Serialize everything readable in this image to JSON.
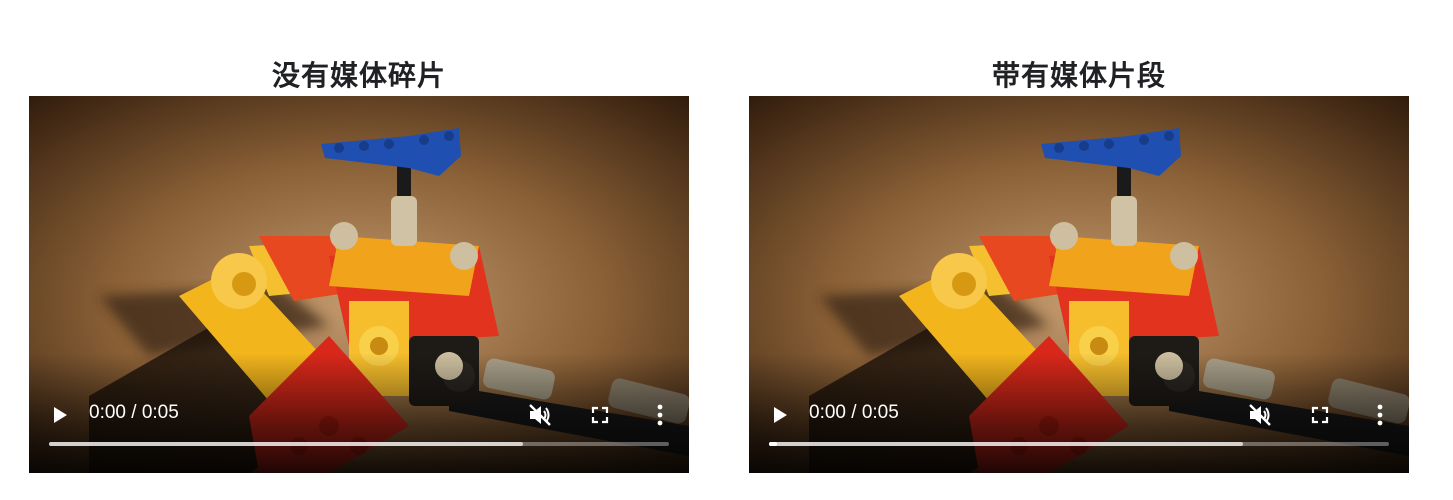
{
  "players": [
    {
      "title": "没有媒体碎片",
      "time": "0:00 / 0:05",
      "buffered_fraction": 0.765,
      "played_fraction": 0.0
    },
    {
      "title": "带有媒体片段",
      "time": "0:00 / 0:05",
      "buffered_fraction": 0.765,
      "played_fraction": 0.012
    }
  ],
  "icons": {
    "play": "play-icon",
    "mute": "muted-speaker-icon",
    "fullscreen": "fullscreen-icon",
    "menu": "more-vert-icon"
  },
  "colors": {
    "title": "#202124",
    "controls": "#ffffff",
    "lego_blue": "#1f4fb0",
    "lego_yellow": "#f2b51c",
    "lego_red": "#e2331e"
  }
}
